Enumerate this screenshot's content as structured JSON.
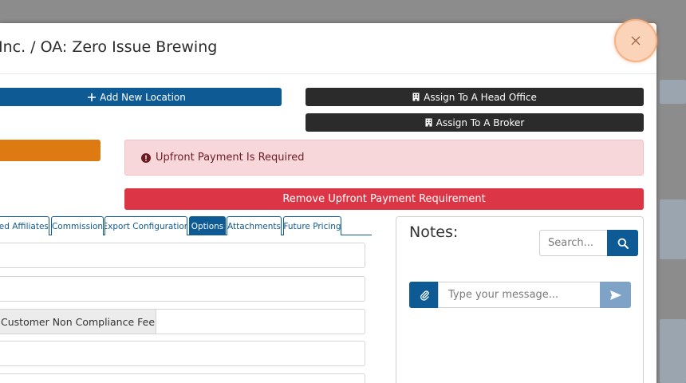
{
  "modal": {
    "title": "Inc. / OA: Zero Issue Brewing"
  },
  "buttons": {
    "add_location": "Add New Location",
    "assign_head_office": "Assign To A Head Office",
    "assign_broker": "Assign To A Broker",
    "remove_upfront": "Remove Upfront Payment Requirement"
  },
  "alert": {
    "text": "Upfront Payment Is Required"
  },
  "tabs": [
    {
      "label": "ked Affiliates",
      "active": false
    },
    {
      "label": "Commission",
      "active": false
    },
    {
      "label": "Export Configuration",
      "active": false
    },
    {
      "label": "Options",
      "active": true
    },
    {
      "label": "Attachments",
      "active": false
    },
    {
      "label": "Future Pricing",
      "active": false
    }
  ],
  "form": {
    "non_compliance_label": "Customer Non Compliance Fee"
  },
  "notes": {
    "title": "Notes:",
    "search_placeholder": "Search...",
    "message_placeholder": "Type your message..."
  },
  "colors": {
    "primary": "#0e5a95",
    "dark": "#2b2b2b",
    "danger": "#dc3545",
    "warning": "#dd7a12",
    "alert_bg": "#f8d7da"
  }
}
